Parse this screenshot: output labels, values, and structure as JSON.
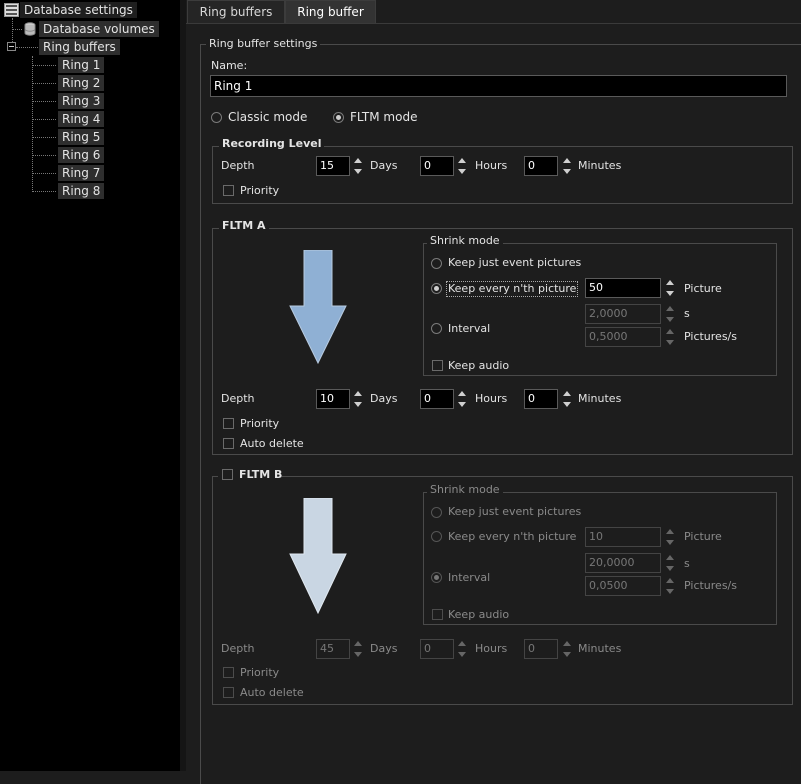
{
  "tree": {
    "root": "Database settings",
    "volumes": "Database volumes",
    "ring_buffers": "Ring buffers",
    "rings": [
      "Ring 1",
      "Ring 2",
      "Ring 3",
      "Ring 4",
      "Ring 5",
      "Ring 6",
      "Ring 7",
      "Ring 8"
    ]
  },
  "tabs": {
    "ring_buffers": "Ring buffers",
    "ring_buffer": "Ring buffer"
  },
  "settings": {
    "group_title": "Ring buffer settings",
    "name_label": "Name:",
    "name_value": "Ring 1",
    "classic_mode": "Classic mode",
    "fltm_mode": "FLTM mode"
  },
  "recording": {
    "title": "Recording Level",
    "depth_label": "Depth",
    "days_value": "15",
    "days_label": "Days",
    "hours_value": "0",
    "hours_label": "Hours",
    "minutes_value": "0",
    "minutes_label": "Minutes",
    "priority": "Priority"
  },
  "fltm_a": {
    "title": "FLTM A",
    "shrink_title": "Shrink mode",
    "keep_event": "Keep just event pictures",
    "keep_nth": "Keep every n'th picture",
    "nth_value": "50",
    "picture_label": "Picture",
    "interval": "Interval",
    "interval_s_value": "2,0000",
    "s_label": "s",
    "interval_ps_value": "0,5000",
    "ps_label": "Pictures/s",
    "keep_audio": "Keep audio",
    "depth_label": "Depth",
    "days_value": "10",
    "days_label": "Days",
    "hours_value": "0",
    "hours_label": "Hours",
    "minutes_value": "0",
    "minutes_label": "Minutes",
    "priority": "Priority",
    "auto_delete": "Auto delete",
    "arrow_color": "#8fb0d4"
  },
  "fltm_b": {
    "title": "FLTM B",
    "shrink_title": "Shrink mode",
    "keep_event": "Keep just event pictures",
    "keep_nth": "Keep every n'th picture",
    "nth_value": "10",
    "picture_label": "Picture",
    "interval": "Interval",
    "interval_s_value": "20,0000",
    "s_label": "s",
    "interval_ps_value": "0,0500",
    "ps_label": "Pictures/s",
    "keep_audio": "Keep audio",
    "depth_label": "Depth",
    "days_value": "45",
    "days_label": "Days",
    "hours_value": "0",
    "hours_label": "Hours",
    "minutes_value": "0",
    "minutes_label": "Minutes",
    "priority": "Priority",
    "auto_delete": "Auto delete",
    "arrow_color": "#c9d6e3"
  }
}
